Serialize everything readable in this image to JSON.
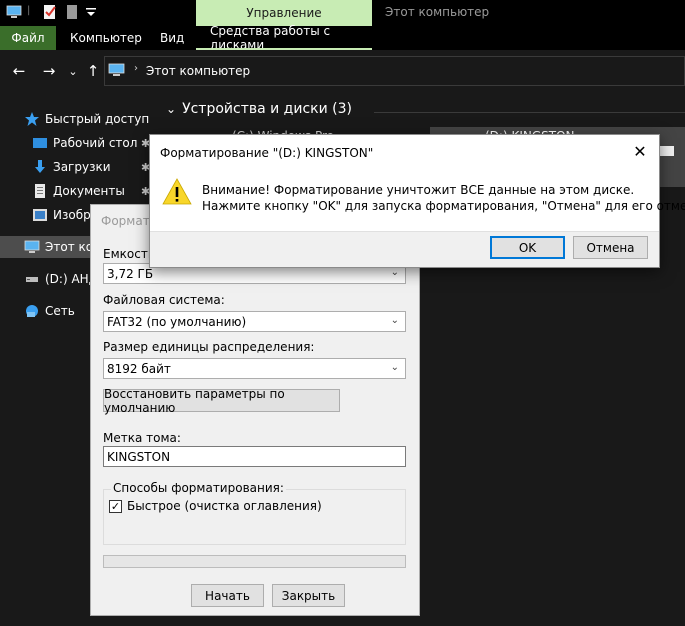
{
  "titlebar": {
    "manage_label": "Управление",
    "window_title": "Этот компьютер"
  },
  "ribbon": {
    "tabs": [
      "Файл",
      "Компьютер",
      "Вид",
      "Средства работы с дисками"
    ]
  },
  "navigation": {
    "back_icon": "←",
    "forward_icon": "→",
    "recent_icon": "⌄",
    "up_icon": "↑",
    "address_sep": "›",
    "address": "Этот компьютер"
  },
  "sidebar": {
    "pin_icon": "✱",
    "items": [
      {
        "label": "Быстрый доступ",
        "icon": "star-icon"
      },
      {
        "label": "Рабочий стол",
        "icon": "desktop-icon"
      },
      {
        "label": "Загрузки",
        "icon": "downloads-icon"
      },
      {
        "label": "Документы",
        "icon": "documents-icon"
      },
      {
        "label": "Изобра",
        "icon": "pictures-icon"
      },
      {
        "label": "Этот комп",
        "icon": "computer-icon"
      },
      {
        "label": "(D:) АНД",
        "icon": "drive-icon"
      },
      {
        "label": "Сеть",
        "icon": "network-icon"
      }
    ]
  },
  "main": {
    "group_chevron": "⌄",
    "group_title": "Устройства и диски (3)",
    "drive_c": "(C:) Windows Pro",
    "drive_d": "(D:) KINGSTON"
  },
  "format_dialog": {
    "title": "Формати",
    "capacity_label": "Емкость:",
    "capacity_value": "3,72 ГБ",
    "fs_label": "Файловая система:",
    "fs_value": "FAT32 (по умолчанию)",
    "cluster_label": "Размер единицы распределения:",
    "cluster_value": "8192 байт",
    "restore_button": "Восстановить параметры по умолчанию",
    "volume_label": "Метка тома:",
    "volume_value": "KINGSTON",
    "options_title": "Способы форматирования:",
    "quick_format_check": "✓",
    "quick_format_label": "Быстрое (очистка оглавления)",
    "start_button": "Начать",
    "close_button": "Закрыть",
    "select_chevron": "⌄"
  },
  "warning_dialog": {
    "title": "Форматирование \"(D:) KINGSTON\"",
    "close_icon": "✕",
    "line1": "Внимание! Форматирование уничтожит ВСЕ данные на этом диске.",
    "line2": "Нажмите кнопку \"OK\" для запуска форматирования, \"Отмена\" для его отмены.",
    "ok_button": "OK",
    "cancel_button": "Отмена"
  },
  "colors": {
    "manage_tab": "#c8ecb4",
    "file_tab": "#3a6e2a",
    "primary_button_border": "#0078d7",
    "warning_icon": "#f8d62a"
  }
}
